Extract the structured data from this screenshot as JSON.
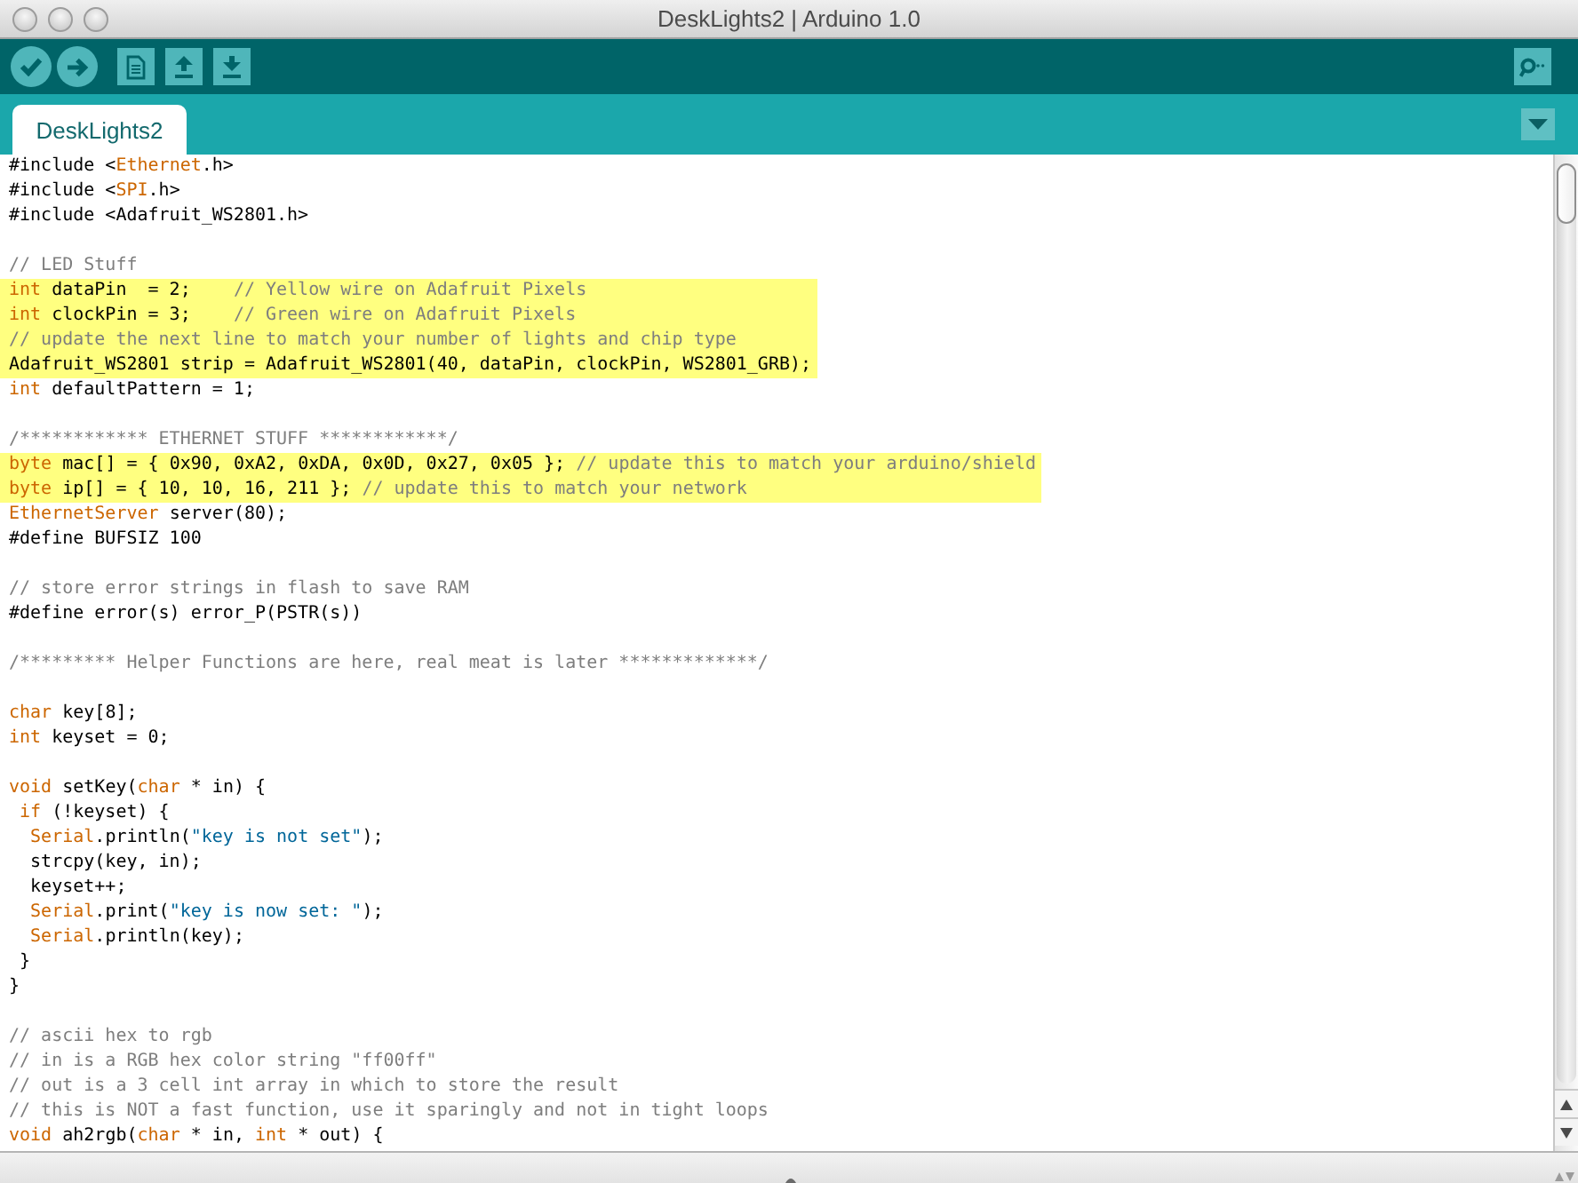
{
  "window": {
    "title": "DeskLights2 | Arduino 1.0"
  },
  "tabs": [
    {
      "label": "DeskLights2",
      "selected": true
    }
  ],
  "editor": {
    "lines": [
      {
        "kind": "code",
        "highlighted": false,
        "tokens": [
          {
            "kind": "plain",
            "text": "#include <"
          },
          {
            "kind": "keyword",
            "text": "Ethernet"
          },
          {
            "kind": "plain",
            "text": ".h>"
          }
        ]
      },
      {
        "kind": "code",
        "highlighted": false,
        "tokens": [
          {
            "kind": "plain",
            "text": "#include <"
          },
          {
            "kind": "keyword",
            "text": "SPI"
          },
          {
            "kind": "plain",
            "text": ".h>"
          }
        ]
      },
      {
        "kind": "code",
        "highlighted": false,
        "tokens": [
          {
            "kind": "plain",
            "text": "#include <Adafruit_WS2801.h>"
          }
        ]
      },
      {
        "kind": "blank"
      },
      {
        "kind": "code",
        "highlighted": false,
        "tokens": [
          {
            "kind": "comment",
            "text": "// LED Stuff"
          }
        ]
      },
      {
        "kind": "code",
        "highlighted": true,
        "tokens": [
          {
            "kind": "keyword",
            "text": "int"
          },
          {
            "kind": "plain",
            "text": " dataPin  = 2;    "
          },
          {
            "kind": "comment",
            "text": "// Yellow wire on Adafruit Pixels"
          }
        ]
      },
      {
        "kind": "code",
        "highlighted": true,
        "tokens": [
          {
            "kind": "keyword",
            "text": "int"
          },
          {
            "kind": "plain",
            "text": " clockPin = 3;    "
          },
          {
            "kind": "comment",
            "text": "// Green wire on Adafruit Pixels"
          }
        ]
      },
      {
        "kind": "code",
        "highlighted": true,
        "tokens": [
          {
            "kind": "comment",
            "text": "// update the next line to match your number of lights and chip type"
          }
        ]
      },
      {
        "kind": "code",
        "highlighted": true,
        "tokens": [
          {
            "kind": "plain",
            "text": "Adafruit_WS2801 strip = Adafruit_WS2801(40, dataPin, clockPin, WS2801_GRB);"
          }
        ]
      },
      {
        "kind": "code",
        "highlighted": false,
        "tokens": [
          {
            "kind": "keyword",
            "text": "int"
          },
          {
            "kind": "plain",
            "text": " defaultPattern = 1;"
          }
        ]
      },
      {
        "kind": "blank"
      },
      {
        "kind": "code",
        "highlighted": false,
        "tokens": [
          {
            "kind": "comment",
            "text": "/************ ETHERNET STUFF ************/"
          }
        ]
      },
      {
        "kind": "code",
        "highlighted": true,
        "tokens": [
          {
            "kind": "keyword",
            "text": "byte"
          },
          {
            "kind": "plain",
            "text": " mac[] = { 0x90, 0xA2, 0xDA, 0x0D, 0x27, 0x05 }; "
          },
          {
            "kind": "comment",
            "text": "// update this to match your arduino/shield"
          }
        ]
      },
      {
        "kind": "code",
        "highlighted": true,
        "tokens": [
          {
            "kind": "keyword",
            "text": "byte"
          },
          {
            "kind": "plain",
            "text": " ip[] = { 10, 10, 16, 211 }; "
          },
          {
            "kind": "comment",
            "text": "// update this to match your network"
          }
        ]
      },
      {
        "kind": "code",
        "highlighted": false,
        "tokens": [
          {
            "kind": "keyword",
            "text": "EthernetServer"
          },
          {
            "kind": "plain",
            "text": " server(80);"
          }
        ]
      },
      {
        "kind": "code",
        "highlighted": false,
        "tokens": [
          {
            "kind": "plain",
            "text": "#define BUFSIZ 100"
          }
        ]
      },
      {
        "kind": "blank"
      },
      {
        "kind": "code",
        "highlighted": false,
        "tokens": [
          {
            "kind": "comment",
            "text": "// store error strings in flash to save RAM"
          }
        ]
      },
      {
        "kind": "code",
        "highlighted": false,
        "tokens": [
          {
            "kind": "plain",
            "text": "#define error(s) error_P(PSTR(s))"
          }
        ]
      },
      {
        "kind": "blank"
      },
      {
        "kind": "code",
        "highlighted": false,
        "tokens": [
          {
            "kind": "comment",
            "text": "/********* Helper Functions are here, real meat is later *************/"
          }
        ]
      },
      {
        "kind": "blank"
      },
      {
        "kind": "code",
        "highlighted": false,
        "tokens": [
          {
            "kind": "keyword",
            "text": "char"
          },
          {
            "kind": "plain",
            "text": " key[8];"
          }
        ]
      },
      {
        "kind": "code",
        "highlighted": false,
        "tokens": [
          {
            "kind": "keyword",
            "text": "int"
          },
          {
            "kind": "plain",
            "text": " keyset = 0;"
          }
        ]
      },
      {
        "kind": "blank"
      },
      {
        "kind": "code",
        "highlighted": false,
        "tokens": [
          {
            "kind": "keyword",
            "text": "void"
          },
          {
            "kind": "plain",
            "text": " setKey("
          },
          {
            "kind": "keyword",
            "text": "char"
          },
          {
            "kind": "plain",
            "text": " * in) {"
          }
        ]
      },
      {
        "kind": "code",
        "highlighted": false,
        "tokens": [
          {
            "kind": "keyword",
            "text": " if"
          },
          {
            "kind": "plain",
            "text": " (!keyset) {"
          }
        ]
      },
      {
        "kind": "code",
        "highlighted": false,
        "tokens": [
          {
            "kind": "keyword",
            "text": "  Serial"
          },
          {
            "kind": "plain",
            "text": ".println("
          },
          {
            "kind": "string",
            "text": "\"key is not set\""
          },
          {
            "kind": "plain",
            "text": ");"
          }
        ]
      },
      {
        "kind": "code",
        "highlighted": false,
        "tokens": [
          {
            "kind": "plain",
            "text": "  strcpy(key, in);"
          }
        ]
      },
      {
        "kind": "code",
        "highlighted": false,
        "tokens": [
          {
            "kind": "plain",
            "text": "  keyset++;"
          }
        ]
      },
      {
        "kind": "code",
        "highlighted": false,
        "tokens": [
          {
            "kind": "keyword",
            "text": "  Serial"
          },
          {
            "kind": "plain",
            "text": ".print("
          },
          {
            "kind": "string",
            "text": "\"key is now set: \""
          },
          {
            "kind": "plain",
            "text": ");"
          }
        ]
      },
      {
        "kind": "code",
        "highlighted": false,
        "tokens": [
          {
            "kind": "keyword",
            "text": "  Serial"
          },
          {
            "kind": "plain",
            "text": ".println(key);"
          }
        ]
      },
      {
        "kind": "code",
        "highlighted": false,
        "tokens": [
          {
            "kind": "plain",
            "text": " }"
          }
        ]
      },
      {
        "kind": "code",
        "highlighted": false,
        "tokens": [
          {
            "kind": "plain",
            "text": "}"
          }
        ]
      },
      {
        "kind": "blank"
      },
      {
        "kind": "code",
        "highlighted": false,
        "tokens": [
          {
            "kind": "comment",
            "text": "// ascii hex to rgb"
          }
        ]
      },
      {
        "kind": "code",
        "highlighted": false,
        "tokens": [
          {
            "kind": "comment",
            "text": "// in is a RGB hex color string \"ff00ff\""
          }
        ]
      },
      {
        "kind": "code",
        "highlighted": false,
        "tokens": [
          {
            "kind": "comment",
            "text": "// out is a 3 cell int array in which to store the result"
          }
        ]
      },
      {
        "kind": "code",
        "highlighted": false,
        "tokens": [
          {
            "kind": "comment",
            "text": "// this is NOT a fast function, use it sparingly and not in tight loops"
          }
        ]
      },
      {
        "kind": "code",
        "highlighted": false,
        "tokens": [
          {
            "kind": "keyword",
            "text": "void"
          },
          {
            "kind": "plain",
            "text": " ah2rgb("
          },
          {
            "kind": "keyword",
            "text": "char"
          },
          {
            "kind": "plain",
            "text": " * in, "
          },
          {
            "kind": "keyword",
            "text": "int"
          },
          {
            "kind": "plain",
            "text": " * out) {"
          }
        ]
      }
    ]
  }
}
